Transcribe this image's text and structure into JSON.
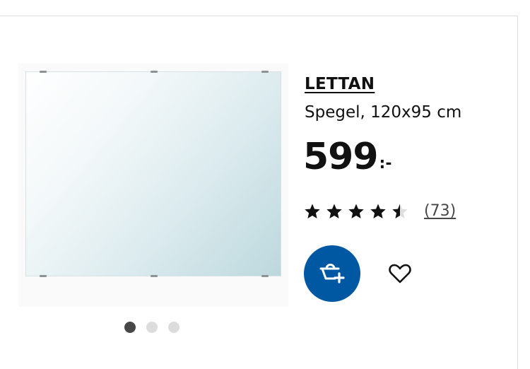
{
  "product": {
    "name": "LETTAN",
    "description": "Spegel, 120x95 cm",
    "price_amount": "599",
    "price_suffix": ":-",
    "rating": 4.5,
    "rating_max": 5,
    "review_count": "(73)"
  },
  "gallery": {
    "image_count": 3,
    "active_index": 0
  },
  "actions": {
    "add_to_cart_icon": "basket-add-icon",
    "favourite_icon": "heart-icon"
  },
  "colors": {
    "accent_blue": "#0058a3",
    "text": "#111111"
  }
}
